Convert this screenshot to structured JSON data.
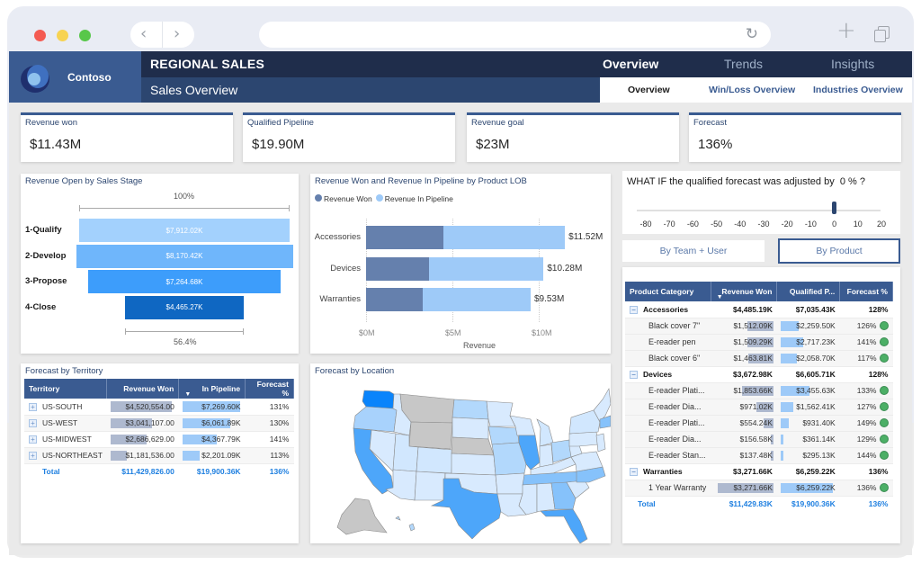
{
  "browser": {
    "back_icon": "‹",
    "forward_icon": "›",
    "reload_icon": "↻",
    "new_tab_icon": "+",
    "address": ""
  },
  "header": {
    "brand": "Contoso",
    "title": "REGIONAL SALES",
    "subtitle": "Sales Overview",
    "main_tabs": [
      {
        "label": "Overview",
        "active": true
      },
      {
        "label": "Trends",
        "active": false
      },
      {
        "label": "Insights",
        "active": false
      }
    ],
    "sub_tabs": [
      {
        "label": "Overview",
        "active": true
      },
      {
        "label": "Win/Loss Overview",
        "active": false
      },
      {
        "label": "Industries Overview",
        "active": false
      }
    ]
  },
  "colors": {
    "brand": "#3a5b91",
    "header_dark": "#1f2d4b",
    "revenue_won": "#6580ad",
    "revenue_pipeline": "#9ecaf8",
    "total_text": "#1e7fe0",
    "status_good": "#4caf66"
  },
  "kpis": [
    {
      "label": "Revenue won",
      "value": "$11.43M"
    },
    {
      "label": "Qualified Pipeline",
      "value": "$19.90M"
    },
    {
      "label": "Revenue goal",
      "value": "$23M"
    },
    {
      "label": "Forecast",
      "value": "136%"
    }
  ],
  "funnel": {
    "title": "Revenue Open by Sales Stage",
    "top_pct": "100%",
    "bottom_pct": "56.4%",
    "stages": [
      {
        "label": "1-Qualify",
        "value": 7912.02,
        "display": "$7,912.02K",
        "color": "#a3d1fd"
      },
      {
        "label": "2-Develop",
        "value": 8170.42,
        "display": "$8,170.42K",
        "color": "#6fb6fb"
      },
      {
        "label": "3-Propose",
        "value": 7264.68,
        "display": "$7,264.68K",
        "color": "#3d9dfb"
      },
      {
        "label": "4-Close",
        "value": 4465.27,
        "display": "$4,465.27K",
        "color": "#0f67c2"
      }
    ]
  },
  "chart_data": {
    "type": "bar",
    "title": "Revenue Won and Revenue In Pipeline by Product LOB",
    "orientation": "horizontal-stacked",
    "categories": [
      "Accessories",
      "Devices",
      "Warranties"
    ],
    "series": [
      {
        "name": "Revenue Won",
        "values": [
          4.49,
          3.67,
          3.27
        ]
      },
      {
        "name": "Revenue In Pipeline",
        "values": [
          7.03,
          6.61,
          6.26
        ]
      }
    ],
    "totals": [
      "$11.52M",
      "$10.28M",
      "$9.53M"
    ],
    "xlabel": "Revenue",
    "ylabel": "",
    "xticks": [
      "$0M",
      "$5M",
      "$10M"
    ],
    "xlim": [
      0,
      12
    ],
    "legend": "top-left",
    "grid": true
  },
  "whatif": {
    "question": "WHAT IF the qualified forecast was adjusted by",
    "value_text": "0 % ?",
    "value": 0,
    "min": -80,
    "max": 20,
    "ticks": [
      "-80",
      "-70",
      "-60",
      "-50",
      "-40",
      "-30",
      "-20",
      "-10",
      "0",
      "10",
      "20"
    ]
  },
  "toggles": [
    {
      "label": "By Team + User",
      "active": false
    },
    {
      "label": "By Product",
      "active": true
    }
  ],
  "territory": {
    "title": "Forecast by Territory",
    "columns": [
      "Territory",
      "Revenue Won",
      "In Pipeline",
      "Forecast %"
    ],
    "rows": [
      {
        "name": "US-SOUTH",
        "won": "$4,520,554.00",
        "won_frac": 1.0,
        "pipe": "$7,269.60K",
        "pipe_frac": 1.0,
        "pct": "131%"
      },
      {
        "name": "US-WEST",
        "won": "$3,041,107.00",
        "won_frac": 0.67,
        "pipe": "$6,061.89K",
        "pipe_frac": 0.83,
        "pct": "130%"
      },
      {
        "name": "US-MIDWEST",
        "won": "$2,686,629.00",
        "won_frac": 0.59,
        "pipe": "$4,367.79K",
        "pipe_frac": 0.6,
        "pct": "141%"
      },
      {
        "name": "US-NORTHEAST",
        "won": "$1,181,536.00",
        "won_frac": 0.26,
        "pipe": "$2,201.09K",
        "pipe_frac": 0.3,
        "pct": "113%"
      }
    ],
    "total": {
      "name": "Total",
      "won": "$11,429,826.00",
      "pipe": "$19,900.36K",
      "pct": "136%"
    }
  },
  "map": {
    "title": "Forecast by Location"
  },
  "product": {
    "columns": [
      "Product Category",
      "Revenue Won",
      "Qualified P...",
      "Forecast %"
    ],
    "groups": [
      {
        "name": "Accessories",
        "won": "$4,485.19K",
        "pipe": "$7,035.43K",
        "pct": "128%",
        "items": [
          {
            "name": "Black cover 7\"",
            "won": "$1,512.09K",
            "won_frac": 0.46,
            "pipe": "$2,259.50K",
            "pipe_frac": 0.35,
            "pct": "126%"
          },
          {
            "name": "E-reader pen",
            "won": "$1,509.29K",
            "won_frac": 0.46,
            "pipe": "$2,717.23K",
            "pipe_frac": 0.43,
            "pct": "141%"
          },
          {
            "name": "Black cover 6\"",
            "won": "$1,463.81K",
            "won_frac": 0.45,
            "pipe": "$2,058.70K",
            "pipe_frac": 0.32,
            "pct": "117%"
          }
        ]
      },
      {
        "name": "Devices",
        "won": "$3,672.98K",
        "pipe": "$6,605.71K",
        "pct": "128%",
        "items": [
          {
            "name": "E-reader Plati...",
            "won": "$1,853.66K",
            "won_frac": 0.57,
            "pipe": "$3,455.63K",
            "pipe_frac": 0.55,
            "pct": "133%"
          },
          {
            "name": "E-reader Dia...",
            "won": "$971.02K",
            "won_frac": 0.3,
            "pipe": "$1,562.41K",
            "pipe_frac": 0.25,
            "pct": "127%"
          },
          {
            "name": "E-reader Plati...",
            "won": "$554.24K",
            "won_frac": 0.17,
            "pipe": "$931.40K",
            "pipe_frac": 0.15,
            "pct": "149%"
          },
          {
            "name": "E-reader Dia...",
            "won": "$156.58K",
            "won_frac": 0.05,
            "pipe": "$361.14K",
            "pipe_frac": 0.06,
            "pct": "129%"
          },
          {
            "name": "E-reader Stan...",
            "won": "$137.48K",
            "won_frac": 0.04,
            "pipe": "$295.13K",
            "pipe_frac": 0.05,
            "pct": "144%"
          }
        ]
      },
      {
        "name": "Warranties",
        "won": "$3,271.66K",
        "pipe": "$6,259.22K",
        "pct": "136%",
        "items": [
          {
            "name": "1 Year Warranty",
            "won": "$3,271.66K",
            "won_frac": 1.0,
            "pipe": "$6,259.22K",
            "pipe_frac": 1.0,
            "pct": "136%"
          }
        ]
      }
    ],
    "total": {
      "name": "Total",
      "won": "$11,429.83K",
      "pipe": "$19,900.36K",
      "pct": "136%"
    }
  }
}
